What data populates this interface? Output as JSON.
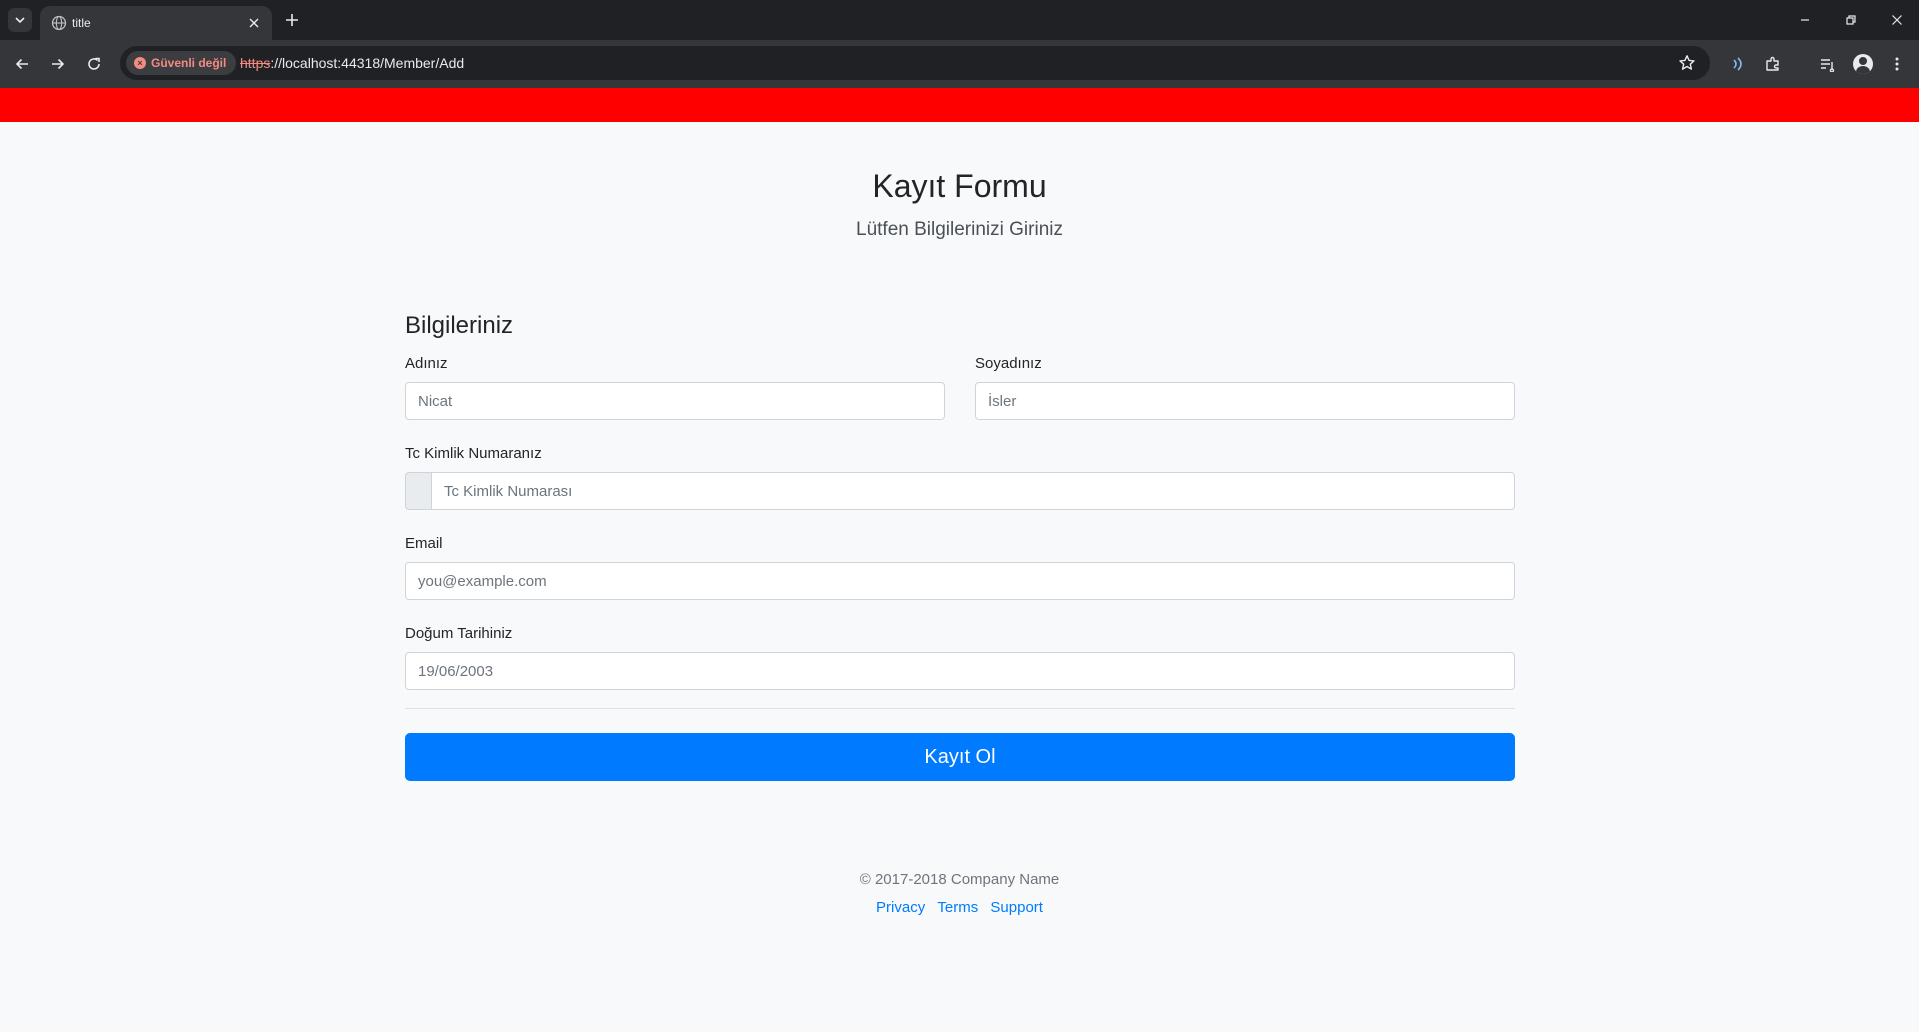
{
  "browser": {
    "tab_title": "title",
    "security_label": "Güvenli değil",
    "url_scheme": "https",
    "url_rest": "://localhost:44318/Member/Add"
  },
  "page": {
    "title": "Kayıt Formu",
    "lead": "Lütfen Bilgilerinizi Giriniz",
    "section_title": "Bilgileriniz"
  },
  "form": {
    "first_name": {
      "label": "Adınız",
      "placeholder": "Nicat",
      "value": ""
    },
    "last_name": {
      "label": "Soyadınız",
      "placeholder": "İsler",
      "value": ""
    },
    "tc": {
      "label": "Tc Kimlik Numaranız",
      "placeholder": "Tc Kimlik Numarası",
      "value": ""
    },
    "email": {
      "label": "Email",
      "placeholder": "you@example.com",
      "value": ""
    },
    "birth_date": {
      "label": "Doğum Tarihiniz",
      "placeholder": "19/06/2003",
      "value": ""
    },
    "submit_label": "Kayıt Ol"
  },
  "footer": {
    "copyright": "© 2017-2018 Company Name",
    "links": [
      "Privacy",
      "Terms",
      "Support"
    ]
  },
  "colors": {
    "banner": "#ff0000",
    "primary": "#007bff",
    "security_warning": "#f28b82"
  },
  "icons": [
    "chevron-down-icon",
    "globe-icon",
    "close-icon",
    "plus-icon",
    "minimize-icon",
    "restore-icon",
    "back-arrow-icon",
    "forward-arrow-icon",
    "reload-icon",
    "star-icon",
    "media-cast-icon",
    "puzzle-icon",
    "reading-list-icon",
    "avatar-icon",
    "more-vert-icon"
  ]
}
